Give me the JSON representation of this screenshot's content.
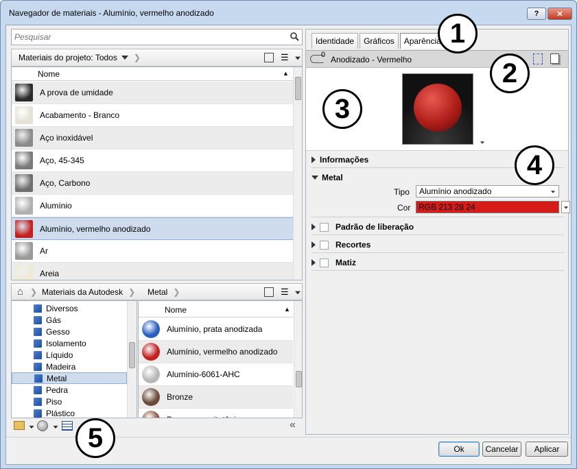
{
  "window": {
    "title": "Navegador de materiais - Alumínio, vermelho anodizado",
    "help_label": "?",
    "close_label": "✕"
  },
  "search": {
    "placeholder": "Pesquisar"
  },
  "project": {
    "filter_label": "Materiais do projeto: Todos",
    "column_header": "Nome",
    "items": [
      {
        "name": "A prova de umidade",
        "thumb": "#2a2a2a"
      },
      {
        "name": "Acabamento - Branco",
        "thumb": "#e4e1d6"
      },
      {
        "name": "Aço inoxidável",
        "thumb": "#8a8a8a"
      },
      {
        "name": "Aço, 45-345",
        "thumb": "#7a7a7a"
      },
      {
        "name": "Aço, Carbono",
        "thumb": "#6e6e6e"
      },
      {
        "name": "Alumínio",
        "thumb": "#b0b0b0"
      },
      {
        "name": "Alumínio, vermelho anodizado",
        "thumb": "#c42020"
      },
      {
        "name": "Ar",
        "thumb": "#9a9a9a"
      },
      {
        "name": "Areia",
        "thumb": "#efe9d6"
      }
    ]
  },
  "library": {
    "breadcrumb": [
      "Materiais da Autodesk",
      "Metal"
    ],
    "categories": [
      "Diversos",
      "Gás",
      "Gesso",
      "Isolamento",
      "Líquido",
      "Madeira",
      "Metal",
      "Pedra",
      "Piso",
      "Plástico"
    ],
    "column_header": "Nome",
    "items": [
      {
        "name": "Alumínio, prata anodizada",
        "thumb": "#2a5fc0"
      },
      {
        "name": "Alumínio, vermelho anodizado",
        "thumb": "#c42020"
      },
      {
        "name": "Alumínio-6061-AHC",
        "thumb": "#b8b8b8"
      },
      {
        "name": "Bronze",
        "thumb": "#6b4a3a"
      },
      {
        "name": "Bronze, arquitetônico",
        "thumb": "#8a5a40"
      }
    ]
  },
  "tabs": [
    "Identidade",
    "Gráficos",
    "Aparência"
  ],
  "asset": {
    "count": "0",
    "name": "Anodizado - Vermelho"
  },
  "sections": {
    "info": "Informações",
    "metal": "Metal",
    "tipo_label": "Tipo",
    "tipo_value": "Alumínio anodizado",
    "cor_label": "Cor",
    "cor_value": "RGB 213 28 24",
    "color": "#d51c18",
    "release": "Padrão de liberação",
    "cuts": "Recortes",
    "tint": "Matiz"
  },
  "buttons": {
    "ok": "Ok",
    "cancel": "Cancelar",
    "apply": "Aplicar"
  },
  "callouts": [
    "1",
    "2",
    "3",
    "4",
    "5"
  ]
}
